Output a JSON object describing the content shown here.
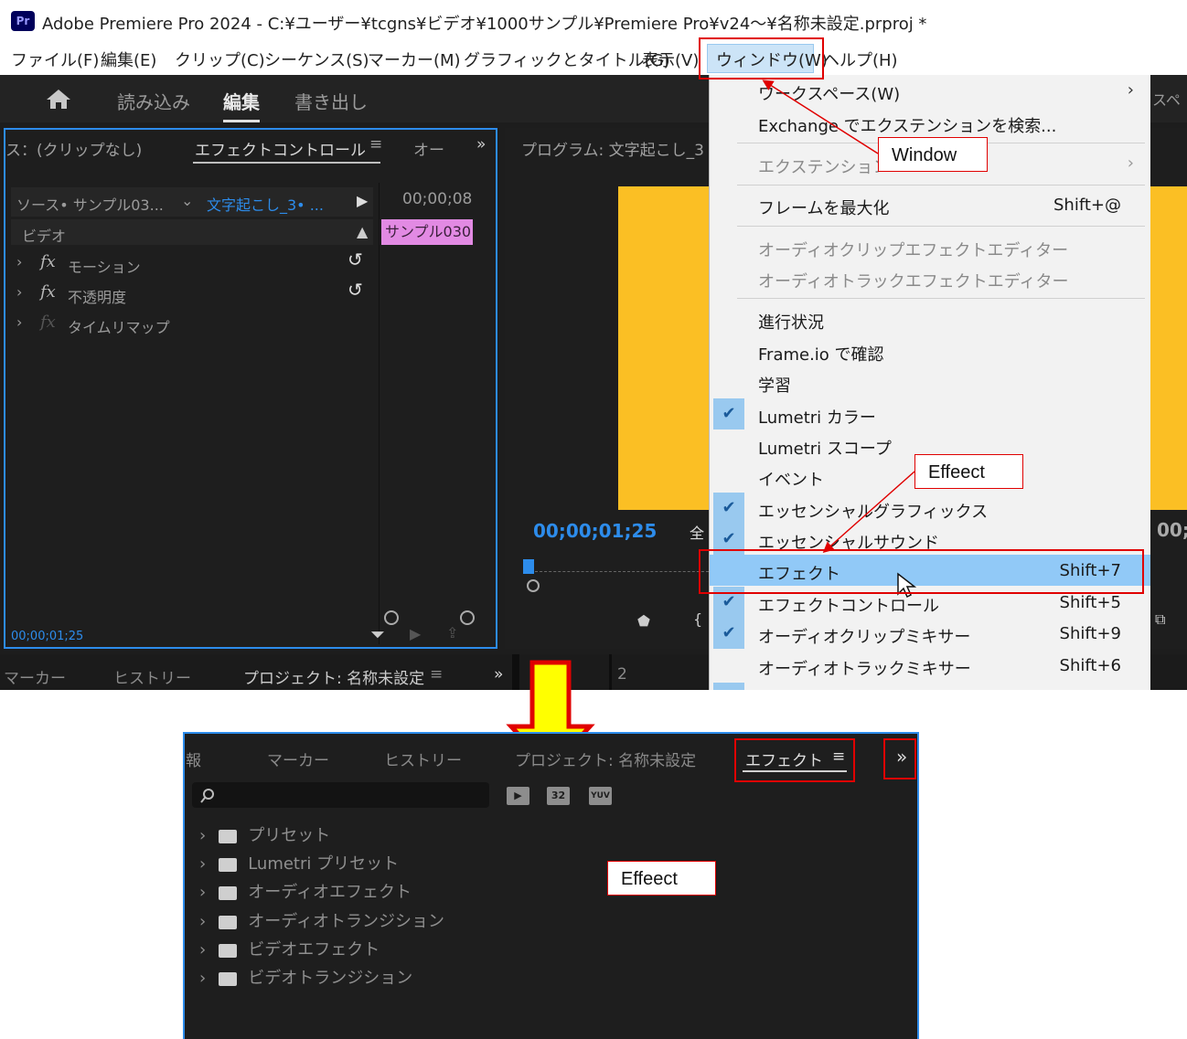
{
  "title_bar": {
    "logo": "Pr",
    "title": "Adobe Premiere Pro 2024 - C:¥ユーザー¥tcgns¥ビデオ¥1000サンプル¥Premiere Pro¥v24〜¥名称未設定.prproj *"
  },
  "menu_bar": [
    "ファイル(F)",
    "編集(E)",
    "クリップ(C)",
    "シーケンス(S)",
    "マーカー(M)",
    "グラフィックとタイトル(G)",
    "表示(V)",
    "ウィンドウ(W)",
    "ヘルプ(H)"
  ],
  "header_tabs": {
    "import": "読み込み",
    "edit": "編集",
    "export": "書き出し",
    "right_fragment": "スペ"
  },
  "left_panel": {
    "tab_source": "ス：(クリップなし)",
    "tab_effect_controls": "エフェクトコントロール",
    "tab_more": "オー",
    "source_label": "ソース• サンプル03...",
    "sequence_label": "文字起こし_3• ...",
    "timecode_top": "00;00;08",
    "video_header": "ビデオ",
    "clip_label": "サンプル030",
    "effects": [
      {
        "label": "モーション",
        "fx": "fx"
      },
      {
        "label": "不透明度",
        "fx": "fx"
      },
      {
        "label": "タイムリマップ",
        "fx": "fx"
      }
    ],
    "timecode_bottom": "00;00;01;25"
  },
  "program_panel": {
    "title": "プログラム: 文字起こし_3",
    "timecode": "00;00;01;25",
    "fit_label": "全",
    "right_timecode": "00;"
  },
  "bottom_strip": [
    "マーカー",
    "ヒストリー",
    "プロジェクト: 名称未設定",
    "2"
  ],
  "dropdown": {
    "items": [
      {
        "label": "ワークスペース(W)",
        "shortcut": "",
        "submenu": true,
        "checked": false,
        "disabled": false
      },
      {
        "label": "Exchange でエクステンションを検索...",
        "shortcut": "",
        "submenu": false,
        "checked": false,
        "disabled": false
      },
      {
        "label": "エクステンション",
        "shortcut": "",
        "submenu": true,
        "checked": false,
        "disabled": true
      },
      {
        "label": "フレームを最大化",
        "shortcut": "Shift+@",
        "submenu": false,
        "checked": false,
        "disabled": false
      },
      {
        "label": "オーディオクリップエフェクトエディター",
        "shortcut": "",
        "submenu": false,
        "checked": false,
        "disabled": true
      },
      {
        "label": "オーディオトラックエフェクトエディター",
        "shortcut": "",
        "submenu": false,
        "checked": false,
        "disabled": true
      },
      {
        "label": "進行状況",
        "shortcut": "",
        "submenu": false,
        "checked": false,
        "disabled": false
      },
      {
        "label": "Frame.io で確認",
        "shortcut": "",
        "submenu": false,
        "checked": false,
        "disabled": false
      },
      {
        "label": "学習",
        "shortcut": "",
        "submenu": false,
        "checked": false,
        "disabled": false
      },
      {
        "label": "Lumetri カラー",
        "shortcut": "",
        "submenu": false,
        "checked": true,
        "disabled": false
      },
      {
        "label": "Lumetri スコープ",
        "shortcut": "",
        "submenu": false,
        "checked": false,
        "disabled": false
      },
      {
        "label": "イベント",
        "shortcut": "",
        "submenu": false,
        "checked": false,
        "disabled": false
      },
      {
        "label": "エッセンシャルグラフィックス",
        "shortcut": "",
        "submenu": false,
        "checked": true,
        "disabled": false
      },
      {
        "label": "エッセンシャルサウンド",
        "shortcut": "",
        "submenu": false,
        "checked": true,
        "disabled": false
      },
      {
        "label": "エフェクト",
        "shortcut": "Shift+7",
        "submenu": false,
        "checked": false,
        "disabled": false
      },
      {
        "label": "エフェクトコントロール",
        "shortcut": "Shift+5",
        "submenu": false,
        "checked": true,
        "disabled": false
      },
      {
        "label": "オーディオクリップミキサー",
        "shortcut": "Shift+9",
        "submenu": false,
        "checked": true,
        "disabled": false
      },
      {
        "label": "オーディオトラックミキサー",
        "shortcut": "Shift+6",
        "submenu": false,
        "checked": false,
        "disabled": false
      }
    ]
  },
  "annotations": {
    "window_callout": "Window",
    "effect_callout_top": "Effeect",
    "effect_callout_bottom": "Effeect"
  },
  "effects_panel": {
    "tabs": [
      "報",
      "マーカー",
      "ヒストリー",
      "プロジェクト: 名称未設定",
      "エフェクト"
    ],
    "badges": [
      "32",
      "YUV"
    ],
    "tree": [
      "プリセット",
      "Lumetri プリセット",
      "オーディオエフェクト",
      "オーディオトランジション",
      "ビデオエフェクト",
      "ビデオトランジション"
    ]
  },
  "colors": {
    "accent": "#2d8ceb",
    "highlight": "#91c9f7",
    "annotation": "#e00000",
    "arrow": "#ffff00",
    "frame": "#fbbf24",
    "clip": "#e28ae3"
  }
}
